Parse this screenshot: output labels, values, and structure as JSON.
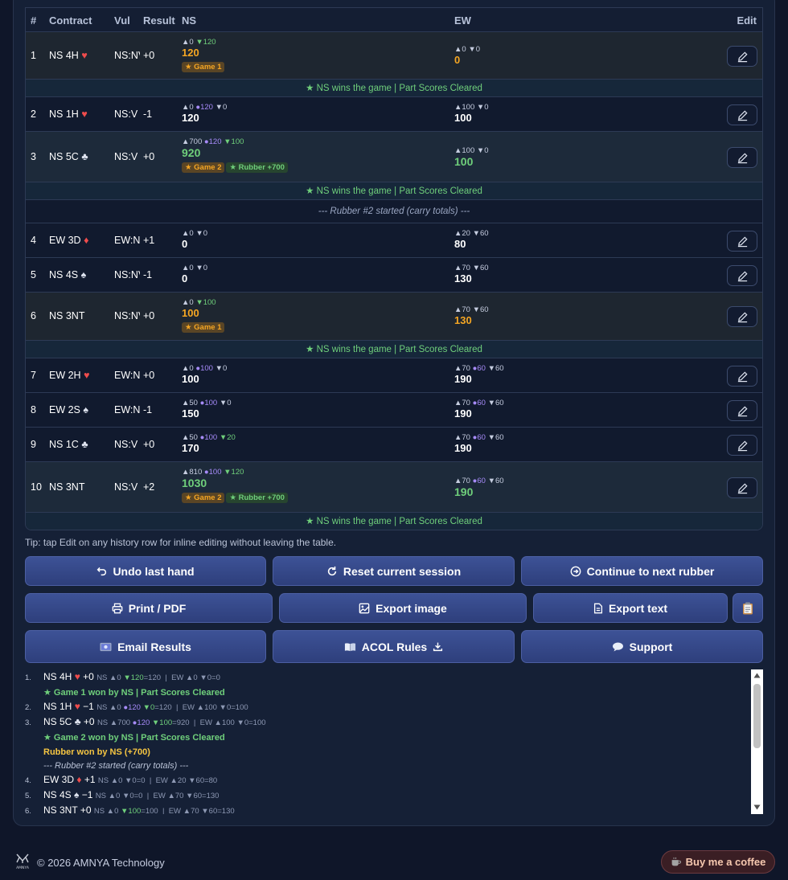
{
  "table": {
    "headers": {
      "num": "#",
      "contract": "Contract",
      "vul": "Vul",
      "result": "Result",
      "ns": "NS",
      "ew": "EW",
      "edit": "Edit"
    },
    "rows": [
      {
        "num": "1",
        "contract": "NS 4H",
        "suit": "♥",
        "vul": "NS:NV",
        "result": "+0",
        "ns_above": "▲0",
        "ns_part": "",
        "ns_below": "▼120",
        "ns_total": "120",
        "ns_badges": [
          "★ Game 1"
        ],
        "ew_above": "▲0",
        "ew_part": "",
        "ew_below": "▼0",
        "ew_total": "0"
      },
      {
        "num": "2",
        "contract": "NS 1H",
        "suit": "♥",
        "vul": "NS:V",
        "result": "-1",
        "ns_above": "▲0",
        "ns_part": "●120",
        "ns_below": "▼0",
        "ns_total": "120",
        "ns_badges": [],
        "ew_above": "▲100",
        "ew_part": "",
        "ew_below": "▼0",
        "ew_total": "100"
      },
      {
        "num": "3",
        "contract": "NS 5C",
        "suit": "♣",
        "vul": "NS:V",
        "result": "+0",
        "ns_above": "▲700",
        "ns_part": "●120",
        "ns_below": "▼100",
        "ns_total": "920",
        "ns_badges": [
          "★ Game 2",
          "★ Rubber +700"
        ],
        "ew_above": "▲100",
        "ew_part": "",
        "ew_below": "▼0",
        "ew_total": "100"
      },
      {
        "num": "4",
        "contract": "EW 3D",
        "suit": "♦",
        "vul": "EW:NV",
        "result": "+1",
        "ns_above": "▲0",
        "ns_part": "",
        "ns_below": "▼0",
        "ns_total": "0",
        "ns_badges": [],
        "ew_above": "▲20",
        "ew_part": "",
        "ew_below": "▼60",
        "ew_total": "80"
      },
      {
        "num": "5",
        "contract": "NS 4S",
        "suit": "♠",
        "vul": "NS:NV",
        "result": "-1",
        "ns_above": "▲0",
        "ns_part": "",
        "ns_below": "▼0",
        "ns_total": "0",
        "ns_badges": [],
        "ew_above": "▲70",
        "ew_part": "",
        "ew_below": "▼60",
        "ew_total": "130"
      },
      {
        "num": "6",
        "contract": "NS 3NT",
        "suit": "",
        "vul": "NS:NV",
        "result": "+0",
        "ns_above": "▲0",
        "ns_part": "",
        "ns_below": "▼100",
        "ns_total": "100",
        "ns_badges": [
          "★ Game 1"
        ],
        "ew_above": "▲70",
        "ew_part": "",
        "ew_below": "▼60",
        "ew_total": "130"
      },
      {
        "num": "7",
        "contract": "EW 2H",
        "suit": "♥",
        "vul": "EW:NV",
        "result": "+0",
        "ns_above": "▲0",
        "ns_part": "●100",
        "ns_below": "▼0",
        "ns_total": "100",
        "ns_badges": [],
        "ew_above": "▲70",
        "ew_part": "●60",
        "ew_below": "▼60",
        "ew_total": "190"
      },
      {
        "num": "8",
        "contract": "EW 2S",
        "suit": "♠",
        "vul": "EW:NV",
        "result": "-1",
        "ns_above": "▲50",
        "ns_part": "●100",
        "ns_below": "▼0",
        "ns_total": "150",
        "ns_badges": [],
        "ew_above": "▲70",
        "ew_part": "●60",
        "ew_below": "▼60",
        "ew_total": "190"
      },
      {
        "num": "9",
        "contract": "NS 1C",
        "suit": "♣",
        "vul": "NS:V",
        "result": "+0",
        "ns_above": "▲50",
        "ns_part": "●100",
        "ns_below": "▼20",
        "ns_total": "170",
        "ns_badges": [],
        "ew_above": "▲70",
        "ew_part": "●60",
        "ew_below": "▼60",
        "ew_total": "190"
      },
      {
        "num": "10",
        "contract": "NS 3NT",
        "suit": "",
        "vul": "NS:V",
        "result": "+2",
        "ns_above": "▲810",
        "ns_part": "●100",
        "ns_below": "▼120",
        "ns_total": "1030",
        "ns_badges": [
          "★ Game 2",
          "★ Rubber +700"
        ],
        "ew_above": "▲70",
        "ew_part": "●60",
        "ew_below": "▼60",
        "ew_total": "190"
      }
    ],
    "banner_game": "★ NS wins the game | Part Scores Cleared",
    "banner_rubber": "--- Rubber #2 started (carry totals) ---"
  },
  "tip": "Tip: tap Edit on any history row for inline editing without leaving the table.",
  "buttons": {
    "undo": "Undo last hand",
    "reset": "Reset current session",
    "continue": "Continue to next rubber",
    "print": "Print / PDF",
    "export_image": "Export image",
    "export_text": "Export text",
    "email": "Email Results",
    "acol": "ACOL Rules",
    "support": "Support"
  },
  "log": {
    "lines": [
      {
        "n": "1.",
        "contract": "NS 4H",
        "suit": "♥",
        "result": "+0",
        "ns_a": "NS ▲0 ",
        "ns_p": "",
        "ns_b": "▼120",
        "ns_t": "=120",
        "ew": "EW ▲0 ▼0=0"
      },
      {
        "n": "2.",
        "contract": "NS 1H",
        "suit": "♥",
        "result": "−1",
        "ns_a": "NS ▲0 ",
        "ns_p": "●120 ",
        "ns_b": "▼0",
        "ns_t": "=120",
        "ew": "EW ▲100 ▼0=100"
      },
      {
        "n": "3.",
        "contract": "NS 5C",
        "suit": "♣",
        "result": "+0",
        "ns_a": "NS ▲700 ",
        "ns_p": "●120 ",
        "ns_b": "▼100",
        "ns_t": "=920",
        "ew": "EW ▲100 ▼0=100"
      },
      {
        "n": "4.",
        "contract": "EW 3D",
        "suit": "♦",
        "result": "+1",
        "ns_a": "NS ▲0 ▼0=0",
        "ns_p": "",
        "ns_b": "",
        "ns_t": "",
        "ew": "EW ▲20 ▼60=80"
      },
      {
        "n": "5.",
        "contract": "NS 4S",
        "suit": "♠",
        "result": "−1",
        "ns_a": "NS ▲0 ▼0=0",
        "ns_p": "",
        "ns_b": "",
        "ns_t": "",
        "ew": "EW ▲70 ▼60=130"
      },
      {
        "n": "6.",
        "contract": "NS 3NT",
        "suit": "",
        "result": "+0",
        "ns_a": "NS ▲0 ",
        "ns_p": "",
        "ns_b": "▼100",
        "ns_t": "=100",
        "ew": "EW ▲70 ▼60=130"
      }
    ],
    "game1": "★ Game 1 won by NS | Part Scores Cleared",
    "game2": "★ Game 2 won by NS | Part Scores Cleared",
    "rubber_won": "Rubber won by NS (+700)",
    "rubber2": "--- Rubber #2 started (carry totals) ---"
  },
  "footer": {
    "copyright": "© 2026 AMNYA Technology",
    "coffee": "Buy me a coffee",
    "logo_text": "AMNYA"
  }
}
